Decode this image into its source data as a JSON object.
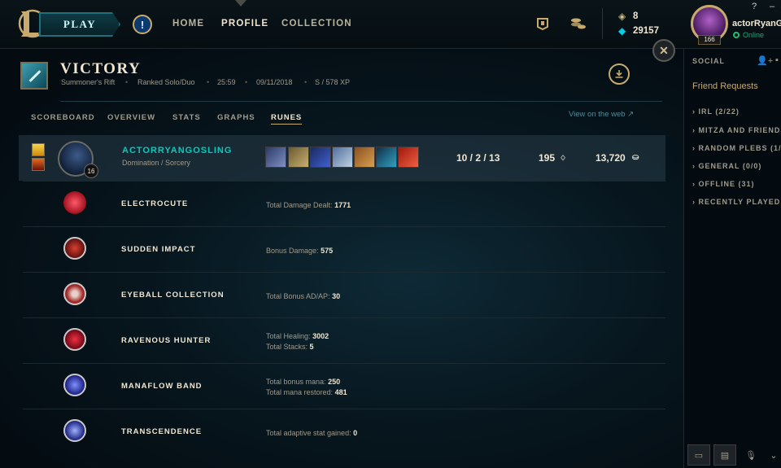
{
  "header": {
    "play_label": "PLAY",
    "alert_symbol": "!",
    "nav": [
      "HOME",
      "PROFILE",
      "COLLECTION"
    ],
    "active_nav": "PROFILE",
    "currency": {
      "rp": "8",
      "be": "29157"
    },
    "username": "actorRyanG",
    "summoner_level": "166",
    "status": "Online",
    "window_controls": {
      "help": "?",
      "minimize": "–"
    }
  },
  "match": {
    "result": "VICTORY",
    "map": "Summoner's Rift",
    "queue": "Ranked Solo/Duo",
    "duration": "25:59",
    "date": "09/11/2018",
    "xp": "S / 578 XP",
    "tabs": [
      "SCOREBOARD",
      "OVERVIEW",
      "STATS",
      "GRAPHS",
      "RUNES"
    ],
    "active_tab": "RUNES",
    "web_link": "View on the web ↗"
  },
  "player": {
    "name": "ACTORRYANGOSLING",
    "trees": "Domination / Sorcery",
    "level": "16",
    "kda": "10 / 2 / 13",
    "cs": "195",
    "gold": "13,720"
  },
  "runes": [
    {
      "name": "ELECTROCUTE",
      "stats": [
        {
          "label": "Total Damage Dealt:",
          "value": "1771"
        }
      ],
      "color": "#d8203a"
    },
    {
      "name": "SUDDEN IMPACT",
      "stats": [
        {
          "label": "Bonus Damage:",
          "value": "575"
        }
      ],
      "color": "#b82e28"
    },
    {
      "name": "EYEBALL COLLECTION",
      "stats": [
        {
          "label": "Total Bonus AD/AP:",
          "value": "30"
        }
      ],
      "color": "#c04040"
    },
    {
      "name": "RAVENOUS HUNTER",
      "stats": [
        {
          "label": "Total Healing:",
          "value": "3002"
        },
        {
          "label": "Total Stacks:",
          "value": "5"
        }
      ],
      "color": "#c01f2a"
    },
    {
      "name": "MANAFLOW BAND",
      "stats": [
        {
          "label": "Total bonus mana:",
          "value": "250"
        },
        {
          "label": "Total mana restored:",
          "value": "481"
        }
      ],
      "color": "#4c5ee0"
    },
    {
      "name": "TRANSCENDENCE",
      "stats": [
        {
          "label": "Total adaptive stat gained:",
          "value": "0"
        }
      ],
      "color": "#5468e8"
    }
  ],
  "social": {
    "title": "SOCIAL",
    "friend_requests": "Friend Requests",
    "groups": [
      "IRL (2/22)",
      "MITZA AND FRIENDS",
      "RANDOM PLEBS (1/",
      "GENERAL (0/0)",
      "OFFLINE (31)",
      "RECENTLY PLAYED"
    ]
  }
}
